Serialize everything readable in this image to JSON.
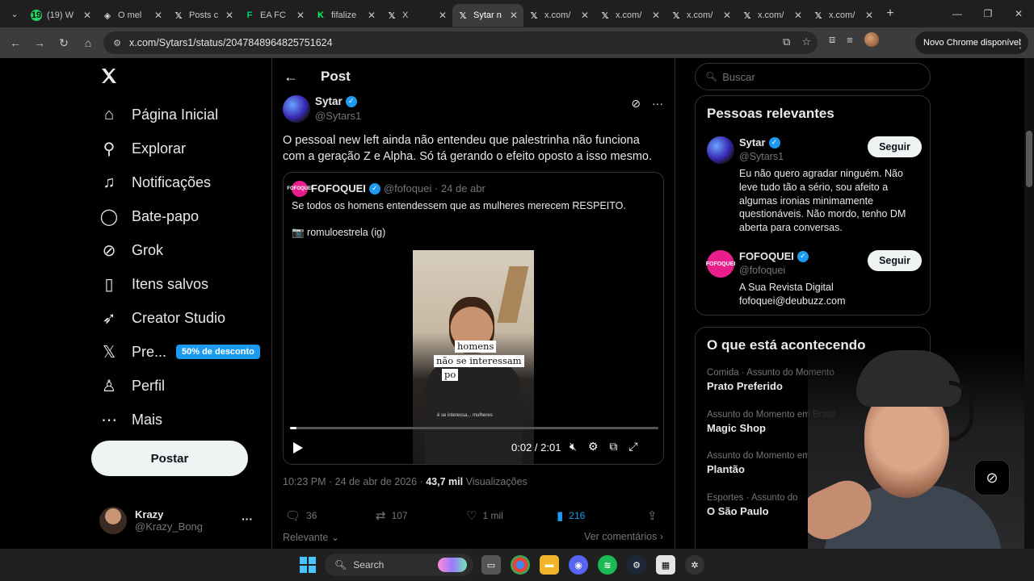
{
  "browser": {
    "tabs": [
      {
        "icon": "whatsapp-icon",
        "badge": "19",
        "title": "(19) W",
        "color": "#25d366"
      },
      {
        "icon": "shield-icon",
        "title": "O mel",
        "color": "#ddd"
      },
      {
        "icon": "x-logo-icon",
        "title": "Posts c",
        "color": "#fff"
      },
      {
        "icon": "fc-icon",
        "title": "EA FC",
        "color": "#00d46a"
      },
      {
        "icon": "k-icon",
        "title": "fifalize",
        "color": "#00ff66"
      },
      {
        "icon": "x-logo-icon",
        "title": "X",
        "color": "#fff"
      },
      {
        "icon": "x-logo-icon",
        "title": "Sytar n",
        "color": "#fff",
        "active": true
      },
      {
        "icon": "x-logo-icon",
        "title": "x.com/",
        "color": "#fff"
      },
      {
        "icon": "x-logo-icon",
        "title": "x.com/",
        "color": "#fff"
      },
      {
        "icon": "x-logo-icon",
        "title": "x.com/",
        "color": "#fff"
      },
      {
        "icon": "x-logo-icon",
        "title": "x.com/",
        "color": "#fff"
      },
      {
        "icon": "x-logo-icon",
        "title": "x.com/",
        "color": "#fff"
      }
    ],
    "url": "x.com/Sytars1/status/2047848964825751624",
    "update_label": "Novo Chrome disponível"
  },
  "nav": {
    "items": [
      {
        "name": "home",
        "label": "Página Inicial",
        "icon": "home-icon"
      },
      {
        "name": "explore",
        "label": "Explorar",
        "icon": "search-icon"
      },
      {
        "name": "notifications",
        "label": "Notificações",
        "icon": "bell-icon"
      },
      {
        "name": "chat",
        "label": "Bate-papo",
        "icon": "chat-icon"
      },
      {
        "name": "grok",
        "label": "Grok",
        "icon": "grok-icon"
      },
      {
        "name": "bookmarks",
        "label": "Itens salvos",
        "icon": "bookmark-icon"
      },
      {
        "name": "creator-studio",
        "label": "Creator Studio",
        "icon": "rocket-icon"
      },
      {
        "name": "premium",
        "label": "Pre...",
        "icon": "x-logo-icon"
      },
      {
        "name": "profile",
        "label": "Perfil",
        "icon": "person-icon"
      },
      {
        "name": "more",
        "label": "Mais",
        "icon": "more-circle-icon"
      }
    ],
    "premium_badge": "50% de desconto",
    "post_button": "Postar",
    "account": {
      "name": "Krazy",
      "handle": "@Krazy_Bong"
    }
  },
  "post": {
    "header": "Post",
    "author": {
      "name": "Sytar",
      "handle": "@Sytars1"
    },
    "text": "O pessoal new left ainda não entendeu que palestrinha não funciona com a geração Z e Alpha. Só tá gerando o efeito oposto a isso mesmo.",
    "quote": {
      "avatar_text": "FOFOQUEI",
      "name": "FOFOQUEI",
      "meta": "@fofoquei · 24 de abr",
      "text": "Se todos os homens entendessem que as mulheres merecem RESPEITO.",
      "credit": "📷 romuloestrela (ig)",
      "video": {
        "caption_lines": [
          "homens",
          "não se interessam",
          "po"
        ],
        "subtitle": "é se interessa... mulheres",
        "time": "0:02 / 2:01",
        "progress": 0.017
      }
    },
    "timestamp_prefix": "10:23 PM · 24 de abr de 2026 ·",
    "views_count": "43,7 mil",
    "views_label": "Visualizações",
    "stats": {
      "replies": "36",
      "reposts": "107",
      "likes": "1 mil",
      "bookmarks": "216"
    },
    "relevant_label": "Relevante",
    "see_comments_label": "Ver comentários"
  },
  "sidebar": {
    "search_placeholder": "Buscar",
    "relevant_people_title": "Pessoas relevantes",
    "people": [
      {
        "name": "Sytar",
        "handle": "@Sytars1",
        "bio": "Eu não quero agradar ninguém. Não leve tudo tão a sério, sou afeito a algumas ironias minimamente questionáveis. Não mordo, tenho DM aberta para conversas.",
        "follow": "Seguir"
      },
      {
        "name": "FOFOQUEI",
        "handle": "@fofoquei",
        "bio": "A Sua Revista Digital fofoquei@deubuzz.com",
        "follow": "Seguir"
      }
    ],
    "trending_title": "O que está acontecendo",
    "trends": [
      {
        "meta": "Comida · Assunto do Momento",
        "name": "Prato Preferido"
      },
      {
        "meta": "Assunto do Momento em Brasil",
        "name": "Magic Shop"
      },
      {
        "meta": "Assunto do Momento em Brasil",
        "name": "Plantão"
      },
      {
        "meta": "Esportes · Assunto do",
        "name": "O São Paulo"
      }
    ]
  },
  "taskbar": {
    "search_label": "Search",
    "apps": [
      "file-explorer-icon",
      "chrome-icon",
      "folder-icon",
      "discord-icon",
      "spotify-icon",
      "steam-icon",
      "app-icon",
      "settings-icon"
    ]
  },
  "colors": {
    "accent": "#1d9bf0",
    "background": "#000000",
    "border": "#2f3336",
    "muted": "#71767b"
  }
}
